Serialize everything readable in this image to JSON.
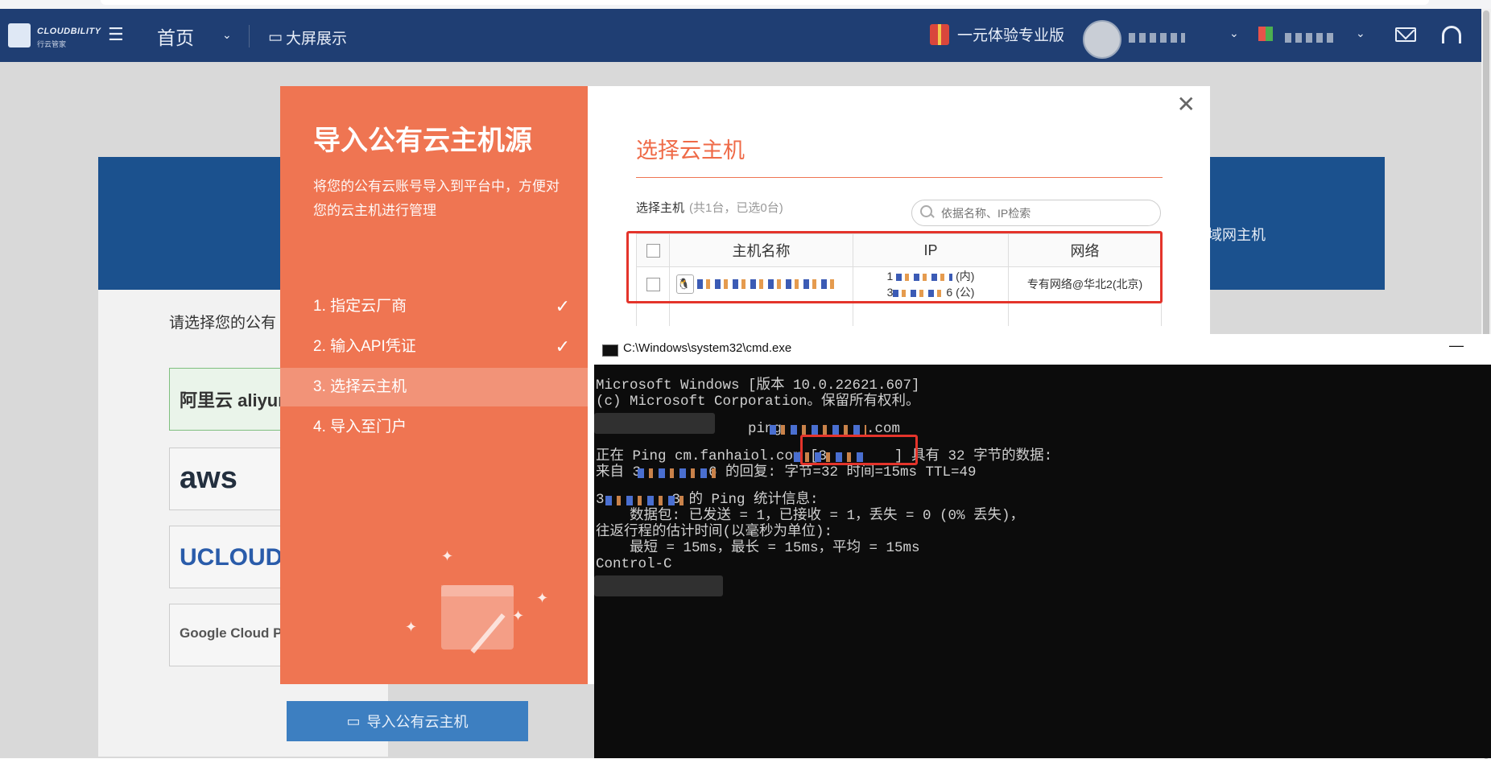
{
  "header": {
    "brand": "CLOUDBILITY",
    "brand_sub": "行云管家",
    "home": "首页",
    "big_screen": "大屏展示",
    "trial": "一元体验专业版"
  },
  "background": {
    "blue_bar_text": "域网主机",
    "select_prompt": "请选择您的公有",
    "vendors": [
      "阿里云 aliyun.com",
      "aws",
      "UCLOUD",
      "Google Cloud Platform"
    ],
    "import_button": "导入公有云主机"
  },
  "modal": {
    "title": "导入公有云主机源",
    "description": "将您的公有云账号导入到平台中，方便对您的云主机进行管理",
    "steps": [
      {
        "label": "1. 指定云厂商",
        "done": true
      },
      {
        "label": "2. 输入API凭证",
        "done": true
      },
      {
        "label": "3. 选择云主机",
        "active": true
      },
      {
        "label": "4. 导入至门户"
      }
    ],
    "right_title": "选择云主机",
    "host_label": "选择主机",
    "host_count": "(共1台，已选0台)",
    "search_placeholder": "依据名称、IP检索",
    "columns": [
      "主机名称",
      "IP",
      "网络"
    ],
    "row": {
      "ip_internal_suffix": "(内)",
      "ip_public_suffix": "(公)",
      "ip_first": "1",
      "ip_second_prefix": "3",
      "ip_second_end": "6",
      "network": "专有网络@华北2(北京)"
    }
  },
  "cmd": {
    "title": "C:\\Windows\\system32\\cmd.exe",
    "lines": [
      "Microsoft Windows [版本 10.0.22621.607]",
      "(c) Microsoft Corporation。保留所有权利。",
      "",
      "                  ping          .com",
      "",
      "正在 Ping cm.fanhaiol.com [3        ] 具有 32 字节的数据:",
      "来自 3        6 的回复: 字节=32 时间=15ms TTL=49",
      "",
      "3        3 的 Ping 统计信息:",
      "    数据包: 已发送 = 1，已接收 = 1，丢失 = 0 (0% 丢失)，",
      "往返行程的估计时间(以毫秒为单位):",
      "    最短 = 15ms，最长 = 15ms，平均 = 15ms",
      "Control-C"
    ]
  },
  "colors": {
    "header_bg": "#1f3e73",
    "modal_orange": "#ef7552",
    "accent_red": "#e4342b",
    "cmd_bg": "#0c0c0c"
  }
}
